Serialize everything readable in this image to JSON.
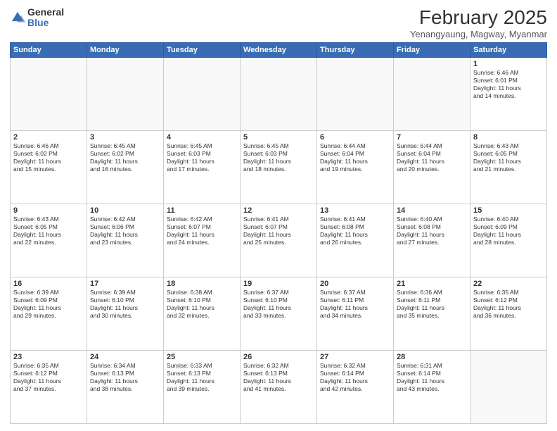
{
  "logo": {
    "general": "General",
    "blue": "Blue"
  },
  "header": {
    "month_year": "February 2025",
    "location": "Yenangyaung, Magway, Myanmar"
  },
  "weekdays": [
    "Sunday",
    "Monday",
    "Tuesday",
    "Wednesday",
    "Thursday",
    "Friday",
    "Saturday"
  ],
  "weeks": [
    [
      {
        "day": "",
        "info": ""
      },
      {
        "day": "",
        "info": ""
      },
      {
        "day": "",
        "info": ""
      },
      {
        "day": "",
        "info": ""
      },
      {
        "day": "",
        "info": ""
      },
      {
        "day": "",
        "info": ""
      },
      {
        "day": "1",
        "info": "Sunrise: 6:46 AM\nSunset: 6:01 PM\nDaylight: 11 hours\nand 14 minutes."
      }
    ],
    [
      {
        "day": "2",
        "info": "Sunrise: 6:46 AM\nSunset: 6:02 PM\nDaylight: 11 hours\nand 15 minutes."
      },
      {
        "day": "3",
        "info": "Sunrise: 6:45 AM\nSunset: 6:02 PM\nDaylight: 11 hours\nand 16 minutes."
      },
      {
        "day": "4",
        "info": "Sunrise: 6:45 AM\nSunset: 6:03 PM\nDaylight: 11 hours\nand 17 minutes."
      },
      {
        "day": "5",
        "info": "Sunrise: 6:45 AM\nSunset: 6:03 PM\nDaylight: 11 hours\nand 18 minutes."
      },
      {
        "day": "6",
        "info": "Sunrise: 6:44 AM\nSunset: 6:04 PM\nDaylight: 11 hours\nand 19 minutes."
      },
      {
        "day": "7",
        "info": "Sunrise: 6:44 AM\nSunset: 6:04 PM\nDaylight: 11 hours\nand 20 minutes."
      },
      {
        "day": "8",
        "info": "Sunrise: 6:43 AM\nSunset: 6:05 PM\nDaylight: 11 hours\nand 21 minutes."
      }
    ],
    [
      {
        "day": "9",
        "info": "Sunrise: 6:43 AM\nSunset: 6:05 PM\nDaylight: 11 hours\nand 22 minutes."
      },
      {
        "day": "10",
        "info": "Sunrise: 6:42 AM\nSunset: 6:06 PM\nDaylight: 11 hours\nand 23 minutes."
      },
      {
        "day": "11",
        "info": "Sunrise: 6:42 AM\nSunset: 6:07 PM\nDaylight: 11 hours\nand 24 minutes."
      },
      {
        "day": "12",
        "info": "Sunrise: 6:41 AM\nSunset: 6:07 PM\nDaylight: 11 hours\nand 25 minutes."
      },
      {
        "day": "13",
        "info": "Sunrise: 6:41 AM\nSunset: 6:08 PM\nDaylight: 11 hours\nand 26 minutes."
      },
      {
        "day": "14",
        "info": "Sunrise: 6:40 AM\nSunset: 6:08 PM\nDaylight: 11 hours\nand 27 minutes."
      },
      {
        "day": "15",
        "info": "Sunrise: 6:40 AM\nSunset: 6:09 PM\nDaylight: 11 hours\nand 28 minutes."
      }
    ],
    [
      {
        "day": "16",
        "info": "Sunrise: 6:39 AM\nSunset: 6:09 PM\nDaylight: 11 hours\nand 29 minutes."
      },
      {
        "day": "17",
        "info": "Sunrise: 6:39 AM\nSunset: 6:10 PM\nDaylight: 11 hours\nand 30 minutes."
      },
      {
        "day": "18",
        "info": "Sunrise: 6:38 AM\nSunset: 6:10 PM\nDaylight: 11 hours\nand 32 minutes."
      },
      {
        "day": "19",
        "info": "Sunrise: 6:37 AM\nSunset: 6:10 PM\nDaylight: 11 hours\nand 33 minutes."
      },
      {
        "day": "20",
        "info": "Sunrise: 6:37 AM\nSunset: 6:11 PM\nDaylight: 11 hours\nand 34 minutes."
      },
      {
        "day": "21",
        "info": "Sunrise: 6:36 AM\nSunset: 6:11 PM\nDaylight: 11 hours\nand 35 minutes."
      },
      {
        "day": "22",
        "info": "Sunrise: 6:35 AM\nSunset: 6:12 PM\nDaylight: 11 hours\nand 36 minutes."
      }
    ],
    [
      {
        "day": "23",
        "info": "Sunrise: 6:35 AM\nSunset: 6:12 PM\nDaylight: 11 hours\nand 37 minutes."
      },
      {
        "day": "24",
        "info": "Sunrise: 6:34 AM\nSunset: 6:13 PM\nDaylight: 11 hours\nand 38 minutes."
      },
      {
        "day": "25",
        "info": "Sunrise: 6:33 AM\nSunset: 6:13 PM\nDaylight: 11 hours\nand 39 minutes."
      },
      {
        "day": "26",
        "info": "Sunrise: 6:32 AM\nSunset: 6:13 PM\nDaylight: 11 hours\nand 41 minutes."
      },
      {
        "day": "27",
        "info": "Sunrise: 6:32 AM\nSunset: 6:14 PM\nDaylight: 11 hours\nand 42 minutes."
      },
      {
        "day": "28",
        "info": "Sunrise: 6:31 AM\nSunset: 6:14 PM\nDaylight: 11 hours\nand 43 minutes."
      },
      {
        "day": "",
        "info": ""
      }
    ]
  ]
}
